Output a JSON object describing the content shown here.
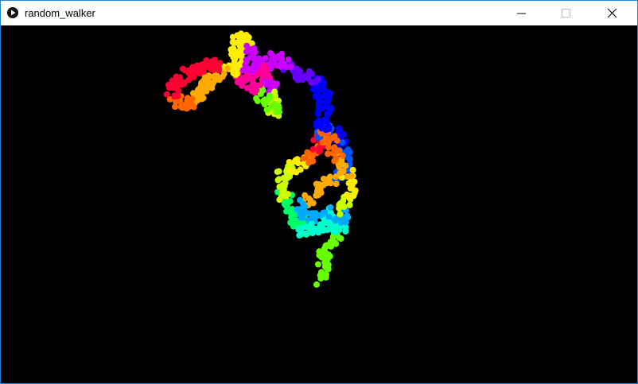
{
  "window": {
    "title": "random_walker",
    "controls": {
      "minimize": "minimize",
      "maximize": "maximize",
      "close": "close"
    },
    "accent_color": "#1883d7",
    "titlebar_color": "#ffffff"
  },
  "sketch": {
    "background_color": "#000000",
    "trail_colors": [
      "#ff0033",
      "#ff6600",
      "#ffaa00",
      "#ffee00",
      "#ccff00",
      "#66ff00",
      "#00ff66",
      "#00ffcc",
      "#00aaff",
      "#0055ff",
      "#0000ff",
      "#6600ff",
      "#cc00ff",
      "#ff0099"
    ]
  }
}
